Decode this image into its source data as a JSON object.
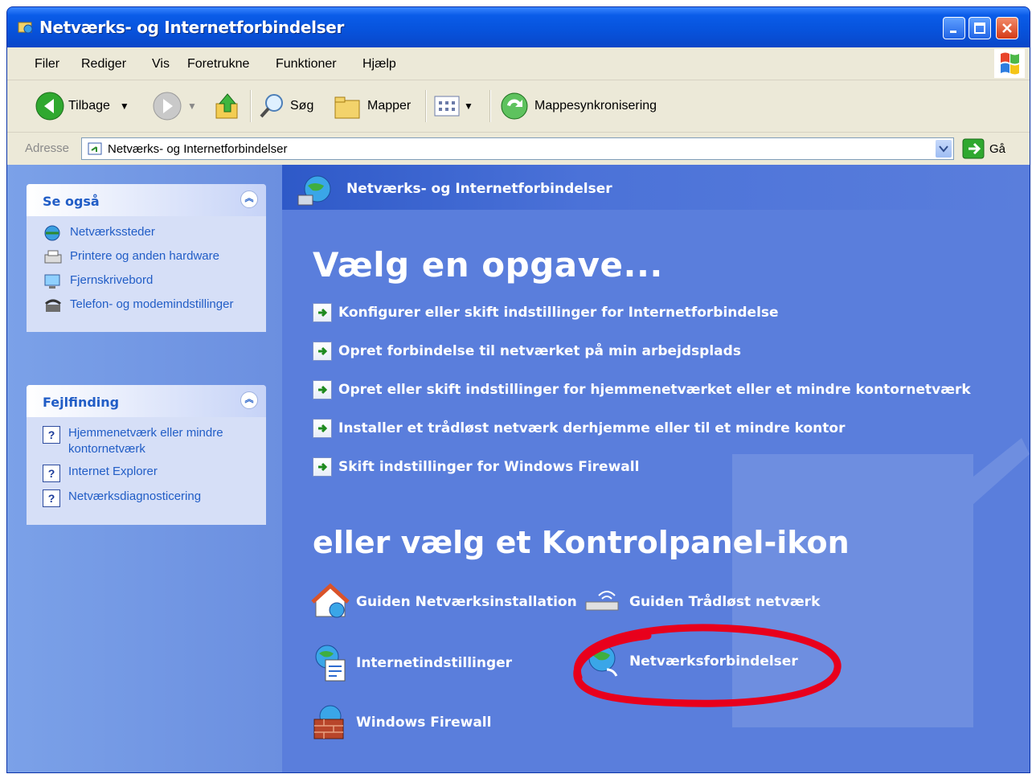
{
  "window": {
    "title": "Netværks- og Internetforbindelser"
  },
  "menu": {
    "items": [
      "Filer",
      "Rediger",
      "Vis",
      "Foretrukne",
      "Funktioner",
      "Hjælp"
    ]
  },
  "toolbar": {
    "back_label": "Tilbage",
    "search_label": "Søg",
    "folders_label": "Mapper",
    "sync_label": "Mappesynkronisering"
  },
  "address": {
    "label": "Adresse",
    "value": "Netværks- og Internetforbindelser",
    "go_label": "Gå"
  },
  "see_also": {
    "title": "Se også",
    "items": [
      "Netværkssteder",
      "Printere og anden hardware",
      "Fjernskrivebord",
      "Telefon- og modemindstillinger"
    ]
  },
  "troubleshoot": {
    "title": "Fejlfinding",
    "items": [
      "Hjemmenetværk eller mindre kontornetværk",
      "Internet Explorer",
      "Netværksdiagnosticering"
    ]
  },
  "main": {
    "header": "Netværks- og Internetforbindelser",
    "pick_task": "Vælg en opgave...",
    "tasks": [
      "Konfigurer eller skift indstillinger for Internetforbindelse",
      "Opret forbindelse til netværket på min arbejdsplads",
      "Opret eller skift indstillinger for hjemmenetværket eller et mindre kontornetværk",
      "Installer et trådløst netværk derhjemme eller til et mindre kontor",
      "Skift indstillinger for Windows Firewall"
    ],
    "pick_icon": "eller vælg et Kontrolpanel-ikon",
    "icons": [
      "Guiden Netværksinstallation",
      "Guiden Trådløst netværk",
      "Internetindstillinger",
      "Netværksforbindelser",
      "Windows Firewall"
    ]
  },
  "colors": {
    "accent": "#0a5ce8",
    "task_pane": "#5a7edc",
    "highlight": "#e8001c"
  }
}
